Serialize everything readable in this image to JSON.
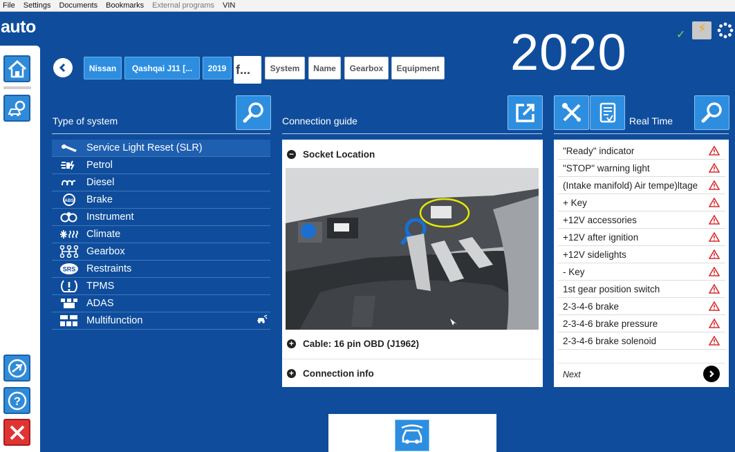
{
  "menu": [
    "File",
    "Settings",
    "Documents",
    "Bookmarks",
    "External programs",
    "VIN"
  ],
  "logo": "auto",
  "year": "2020",
  "breadcrumb": {
    "make": "Nissan",
    "model": "Qashqai J11 [...",
    "year": "2019",
    "field": "f...",
    "system": "System",
    "name": "Name",
    "gearbox": "Gearbox",
    "equipment": "Equipment"
  },
  "systems_panel": {
    "title": "Type of system",
    "items": [
      {
        "label": "Service Light Reset (SLR)",
        "icon": "wrench-icon",
        "selected": true
      },
      {
        "label": "Petrol",
        "icon": "petrol-injector-icon"
      },
      {
        "label": "Diesel",
        "icon": "diesel-glowplug-icon"
      },
      {
        "label": "Brake",
        "icon": "abs-icon"
      },
      {
        "label": "Instrument",
        "icon": "instrument-icon"
      },
      {
        "label": "Climate",
        "icon": "climate-icon"
      },
      {
        "label": "Gearbox",
        "icon": "gearbox-icon"
      },
      {
        "label": "Restraints",
        "icon": "srs-icon"
      },
      {
        "label": "TPMS",
        "icon": "tpms-icon"
      },
      {
        "label": "ADAS",
        "icon": "adas-icon"
      },
      {
        "label": "Multifunction",
        "icon": "multifunction-icon"
      }
    ],
    "srs_text": "SRS",
    "abs_text": "ABS"
  },
  "guide_panel": {
    "title": "Connection guide",
    "rows": {
      "socket": "Socket Location",
      "cable": "Cable: 16 pin OBD (J1962)",
      "info": "Connection info"
    },
    "row_signs": {
      "open": "−",
      "closed": "+"
    }
  },
  "realtime_panel": {
    "title": "Real Time",
    "items": [
      "\"Ready\" indicator",
      "\"STOP\" warning light",
      "(Intake manifold) Air tempe)ltage",
      "+ Key",
      "+12V accessories",
      "+12V after ignition",
      "+12V sidelights",
      "- Key",
      "1st gear position switch",
      "2-3-4-6 brake",
      "2-3-4-6 brake pressure",
      "2-3-4-6 brake solenoid"
    ],
    "next_label": "Next"
  },
  "colors": {
    "background": "#0f4d9c",
    "accent_button": "#2d8ee0",
    "warning": "#d92b2b",
    "check": "#7fd84a"
  }
}
